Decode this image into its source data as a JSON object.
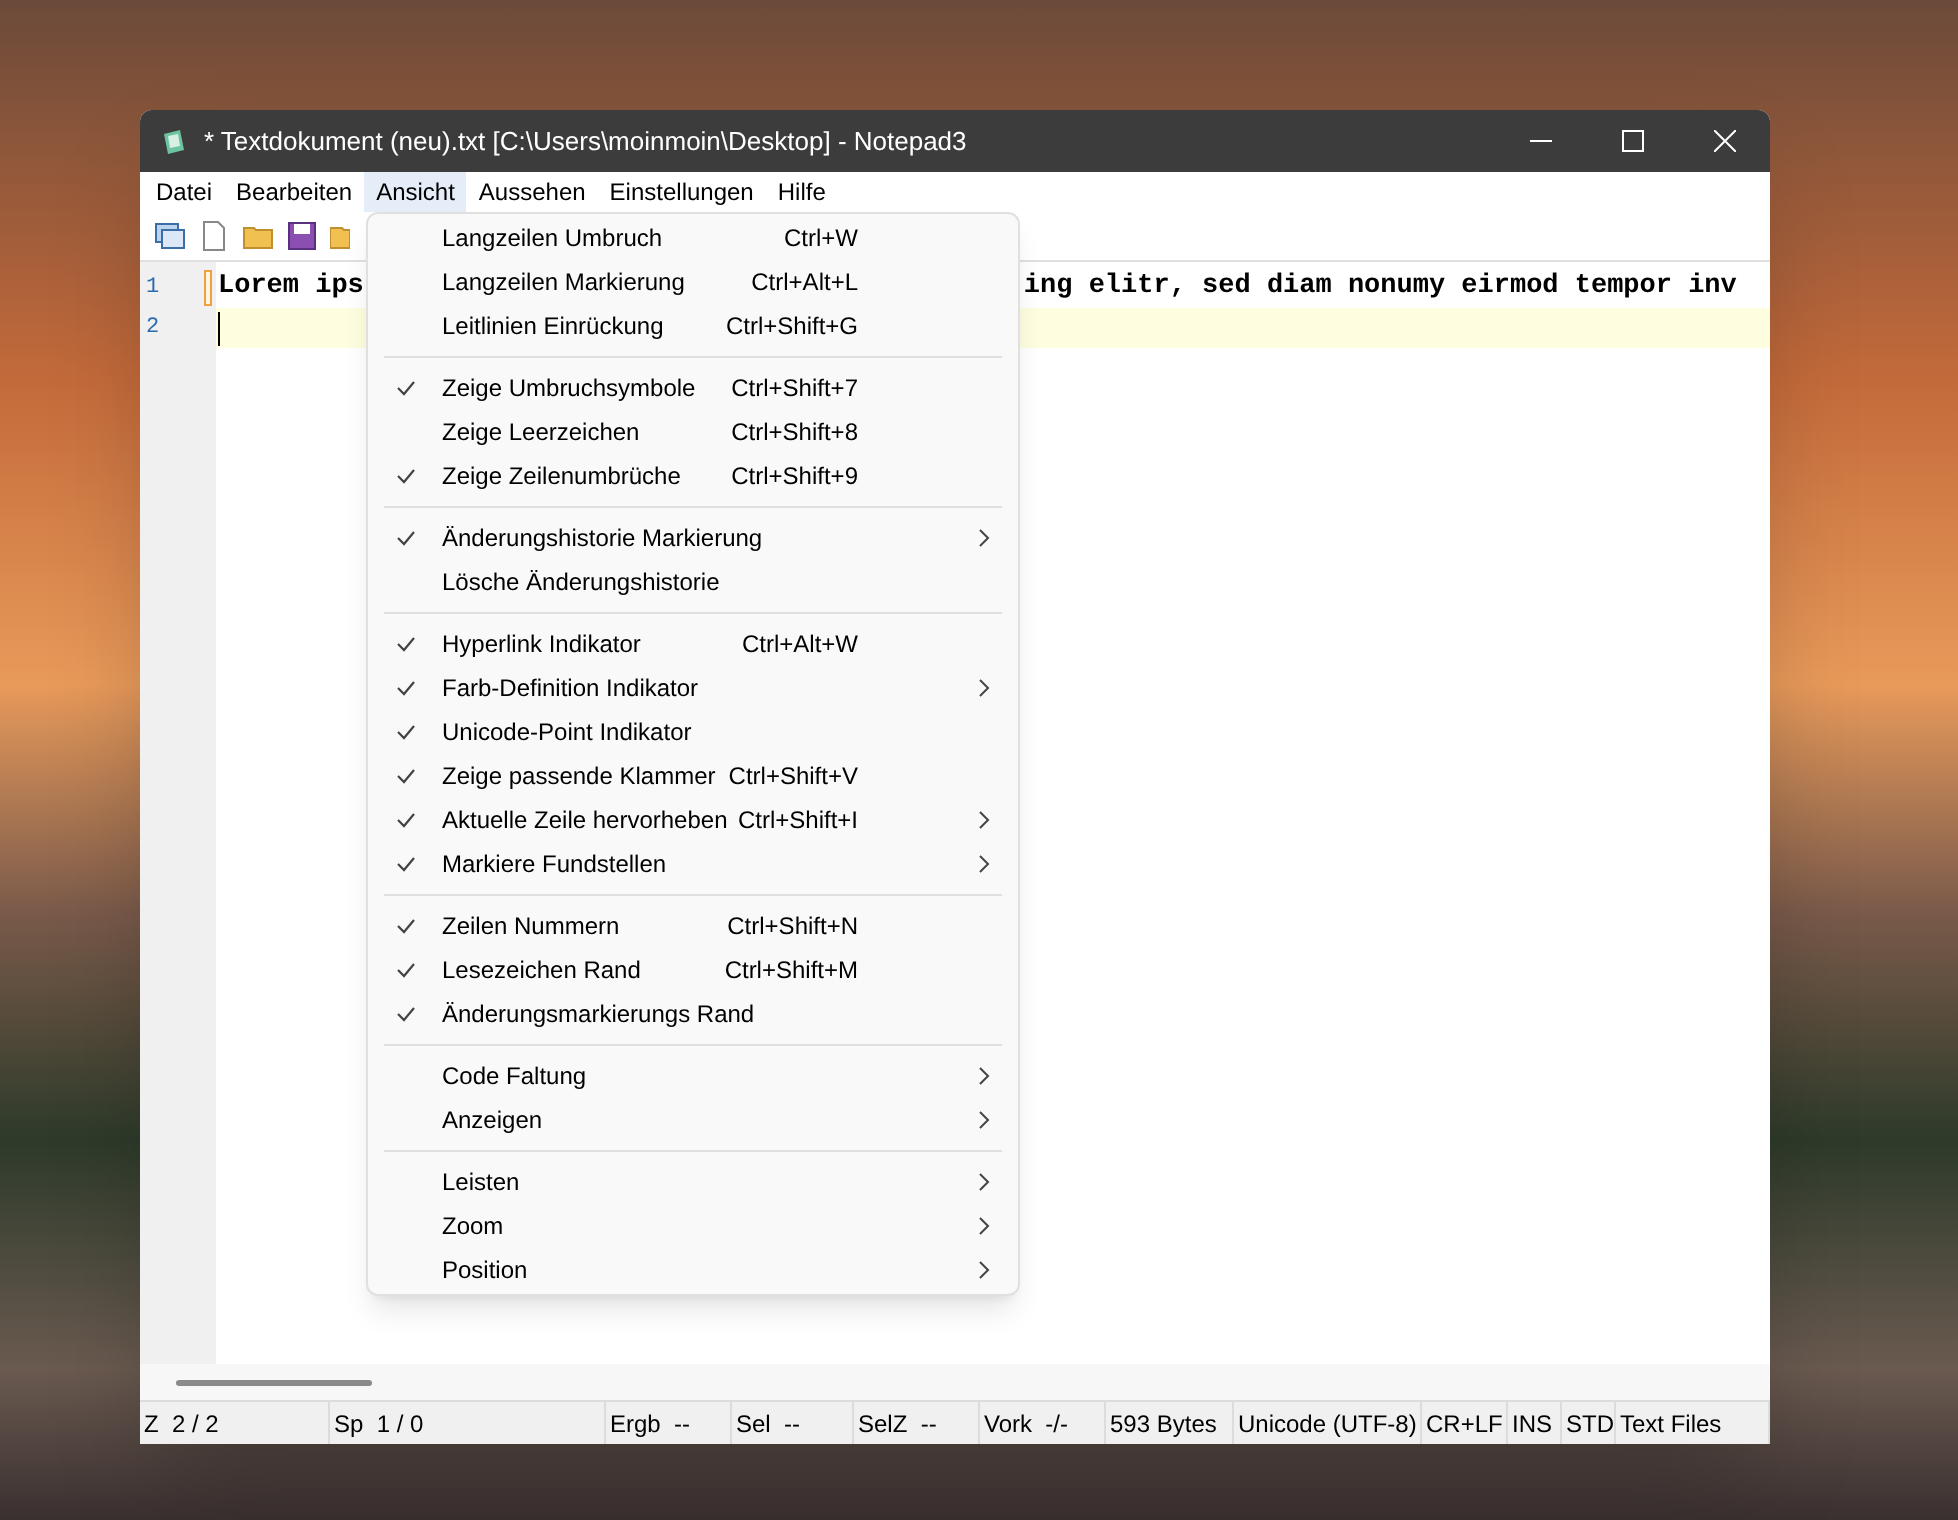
{
  "window": {
    "title": "* Textdokument (neu).txt [C:\\Users\\moinmoin\\Desktop] - Notepad3"
  },
  "menu_bar": [
    {
      "label": "Datei",
      "selected": false
    },
    {
      "label": "Bearbeiten",
      "selected": false
    },
    {
      "label": "Ansicht",
      "selected": true
    },
    {
      "label": "Aussehen",
      "selected": false
    },
    {
      "label": "Einstellungen",
      "selected": false
    },
    {
      "label": "Hilfe",
      "selected": false
    }
  ],
  "editor": {
    "lines": [
      {
        "number": "1",
        "text_before": "Lorem ips",
        "text_after": "ing elitr, sed diam nonumy eirmod tempor inv",
        "current": false,
        "bookmark": true
      },
      {
        "number": "2",
        "current": true,
        "bookmark": false
      }
    ]
  },
  "dropdown_menu": {
    "groups": [
      [
        {
          "label": "Langzeilen Umbruch",
          "shortcut": "Ctrl+W",
          "checked": false,
          "submenu": false
        },
        {
          "label": "Langzeilen Markierung",
          "shortcut": "Ctrl+Alt+L",
          "checked": false,
          "submenu": false
        },
        {
          "label": "Leitlinien Einrückung",
          "shortcut": "Ctrl+Shift+G",
          "checked": false,
          "submenu": false
        }
      ],
      [
        {
          "label": "Zeige Umbruchsymbole",
          "shortcut": "Ctrl+Shift+7",
          "checked": true,
          "submenu": false
        },
        {
          "label": "Zeige Leerzeichen",
          "shortcut": "Ctrl+Shift+8",
          "checked": false,
          "submenu": false
        },
        {
          "label": "Zeige Zeilenumbrüche",
          "shortcut": "Ctrl+Shift+9",
          "checked": true,
          "submenu": false
        }
      ],
      [
        {
          "label": "Änderungshistorie Markierung",
          "checked": true,
          "submenu": true
        },
        {
          "label": "Lösche Änderungshistorie",
          "checked": false,
          "submenu": false
        }
      ],
      [
        {
          "label": "Hyperlink Indikator",
          "shortcut": "Ctrl+Alt+W",
          "checked": true,
          "submenu": false
        },
        {
          "label": "Farb-Definition Indikator",
          "checked": true,
          "submenu": true
        },
        {
          "label": "Unicode-Point Indikator",
          "checked": true,
          "submenu": false
        },
        {
          "label": "Zeige passende Klammer",
          "shortcut": "Ctrl+Shift+V",
          "checked": true,
          "submenu": false
        },
        {
          "label": "Aktuelle Zeile hervorheben",
          "shortcut": "Ctrl+Shift+I",
          "checked": true,
          "submenu": true
        },
        {
          "label": "Markiere Fundstellen",
          "checked": true,
          "submenu": true
        }
      ],
      [
        {
          "label": "Zeilen Nummern",
          "shortcut": "Ctrl+Shift+N",
          "checked": true,
          "submenu": false
        },
        {
          "label": "Lesezeichen Rand",
          "shortcut": "Ctrl+Shift+M",
          "checked": true,
          "submenu": false
        },
        {
          "label": "Änderungsmarkierungs Rand",
          "checked": true,
          "submenu": false
        }
      ],
      [
        {
          "label": "Code Faltung",
          "checked": false,
          "submenu": true
        },
        {
          "label": "Anzeigen",
          "checked": false,
          "submenu": true
        }
      ],
      [
        {
          "label": "Leisten",
          "checked": false,
          "submenu": true
        },
        {
          "label": "Zoom",
          "checked": false,
          "submenu": true
        },
        {
          "label": "Position",
          "checked": false,
          "submenu": true
        }
      ]
    ]
  },
  "status_bar": [
    "Z  2 / 2",
    "Sp  1 / 0",
    "Ergb  --",
    "Sel  --",
    "SelZ  --",
    "Vork  -/-",
    "593 Bytes",
    "Unicode (UTF-8)",
    "CR+LF",
    "INS",
    "STD",
    "Text Files"
  ]
}
